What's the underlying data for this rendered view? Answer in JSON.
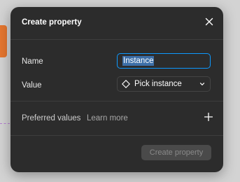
{
  "dialog": {
    "title": "Create property"
  },
  "fields": {
    "name_label": "Name",
    "name_value": "Instance",
    "value_label": "Value",
    "value_selected": "Pick instance"
  },
  "preferred": {
    "label": "Preferred values",
    "learn_more": "Learn more"
  },
  "footer": {
    "create_label": "Create property"
  },
  "icons": {
    "close": "close-icon",
    "instance": "diamond-icon",
    "dropdown": "chevron-down-icon",
    "add": "plus-icon"
  },
  "colors": {
    "dialog_bg": "#2c2c2c",
    "focus_border": "#0d99ff",
    "selection": "#3d6fa8",
    "disabled_button": "#4a4a4a"
  }
}
